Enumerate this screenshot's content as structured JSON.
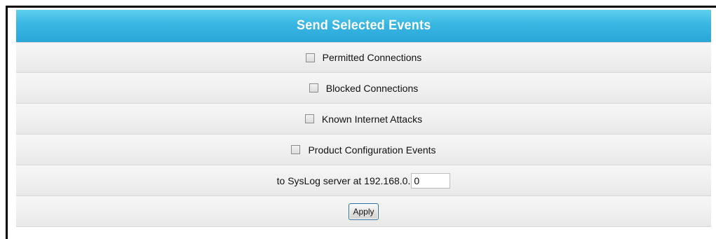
{
  "panel": {
    "title": "Send Selected Events",
    "accent_color": "#38b6e2"
  },
  "events": [
    {
      "label": "Permitted Connections",
      "checked": false
    },
    {
      "label": "Blocked Connections",
      "checked": false
    },
    {
      "label": "Known Internet Attacks",
      "checked": false
    },
    {
      "label": "Product Configuration Events",
      "checked": false
    }
  ],
  "syslog": {
    "label": "to SysLog server at 192.168.0.",
    "value": "0"
  },
  "actions": {
    "apply_label": "Apply"
  }
}
